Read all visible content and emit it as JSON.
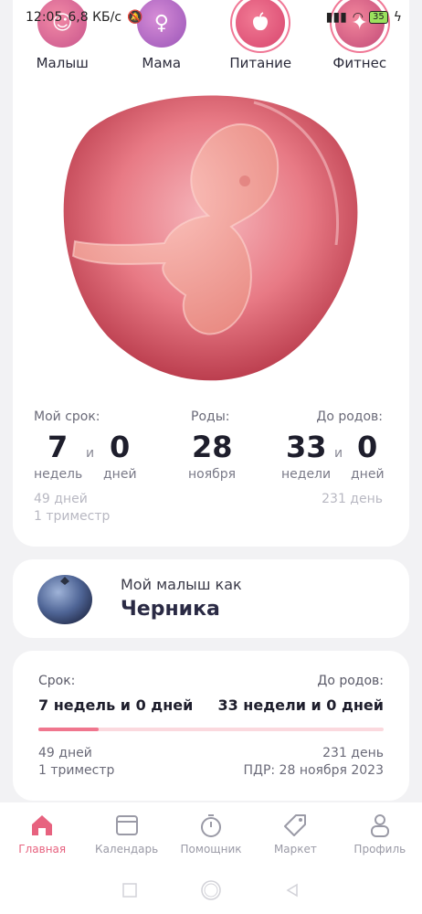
{
  "status_bar": {
    "time": "12:05",
    "speed": "6,8 КБ/с",
    "battery": "35"
  },
  "categories": [
    {
      "label": "Малыш",
      "icon": "baby-icon"
    },
    {
      "label": "Мама",
      "icon": "mother-icon"
    },
    {
      "label": "Питание",
      "icon": "apple-icon"
    },
    {
      "label": "Фитнес",
      "icon": "fitness-icon"
    }
  ],
  "summary": {
    "term_label": "Мой срок:",
    "term_weeks": "7",
    "term_weeks_unit": "недель",
    "and": "и",
    "term_days": "0",
    "term_days_unit": "дней",
    "birth_label": "Роды:",
    "birth_day": "28",
    "birth_month": "ноября",
    "until_label": "До родов:",
    "until_weeks": "33",
    "until_weeks_unit": "недели",
    "until_days": "0",
    "until_days_unit": "дней",
    "days_passed": "49 дней",
    "trimester": "1 триместр",
    "days_left": "231 день"
  },
  "fruit": {
    "subtitle": "Мой малыш как",
    "name": "Черника"
  },
  "progress": {
    "term_label": "Срок:",
    "term_value": "7 недель и 0 дней",
    "until_label": "До родов:",
    "until_value": "33 недели и 0 дней",
    "fraction": 0.175,
    "days_passed": "49 дней",
    "trimester": "1 триместр",
    "days_left": "231 день",
    "due_date": "ПДР: 28 ноября 2023"
  },
  "nav": [
    {
      "label": "Главная",
      "icon": "home-icon",
      "active": true
    },
    {
      "label": "Календарь",
      "icon": "calendar-icon",
      "active": false
    },
    {
      "label": "Помощник",
      "icon": "stopwatch-icon",
      "active": false
    },
    {
      "label": "Маркет",
      "icon": "tag-icon",
      "active": false
    },
    {
      "label": "Профиль",
      "icon": "profile-icon",
      "active": false
    }
  ],
  "colors": {
    "accent": "#e7627f",
    "progress_track": "#fbd9de",
    "progress_fill": "#f0768e"
  }
}
